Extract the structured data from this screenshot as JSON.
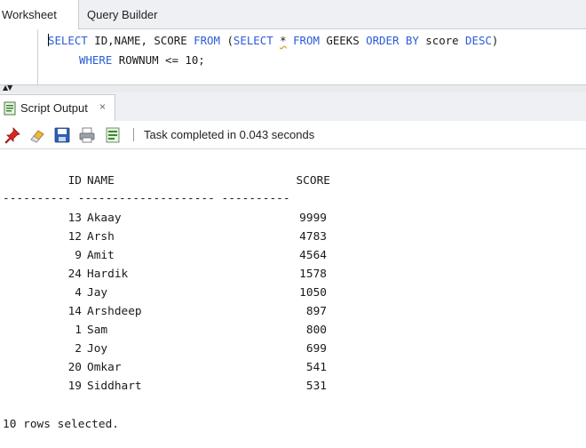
{
  "tabs": {
    "worksheet": "Worksheet",
    "query_builder": "Query Builder"
  },
  "editor": {
    "line1": {
      "caret_char": "S",
      "kw_select_rest": "ELECT",
      "cols": " ID,NAME, SCORE ",
      "kw_from": "FROM",
      "open": " (",
      "kw_select2": "SELECT",
      "space1": " ",
      "star": "*",
      "space2": " ",
      "kw_from2": "FROM",
      "table": " GEEKS ",
      "kw_order_by": "ORDER BY",
      "col": " score ",
      "kw_desc": "DESC",
      "close": ")"
    },
    "line2": {
      "kw_where": "WHERE",
      "cond": " ROWNUM <= 10;"
    }
  },
  "output_panel": {
    "tab_label": "Script Output",
    "close_symbol": "×",
    "status_text": "Task completed in 0.043 seconds"
  },
  "result": {
    "headers": {
      "id": "ID",
      "name": "NAME",
      "score": "SCORE"
    },
    "dash_line": "---------- -------------------- ----------",
    "rows": [
      {
        "id": "13",
        "name": "Akaay",
        "score": "9999"
      },
      {
        "id": "12",
        "name": "Arsh",
        "score": "4783"
      },
      {
        "id": "9",
        "name": "Amit",
        "score": "4564"
      },
      {
        "id": "24",
        "name": "Hardik",
        "score": "1578"
      },
      {
        "id": "4",
        "name": "Jay",
        "score": "1050"
      },
      {
        "id": "14",
        "name": "Arshdeep",
        "score": "897"
      },
      {
        "id": "1",
        "name": "Sam",
        "score": "800"
      },
      {
        "id": "2",
        "name": "Joy",
        "score": "699"
      },
      {
        "id": "20",
        "name": "Omkar",
        "score": "541"
      },
      {
        "id": "19",
        "name": "Siddhart",
        "score": "531"
      }
    ],
    "footer": "10 rows selected."
  },
  "icons": {
    "pin": "pin-icon",
    "eraser": "eraser-icon",
    "save": "save-icon",
    "print": "print-icon",
    "script_output": "script-output-icon"
  },
  "colors": {
    "keyword": "#2a5bd7",
    "tab_bar": "#eef0f3"
  }
}
